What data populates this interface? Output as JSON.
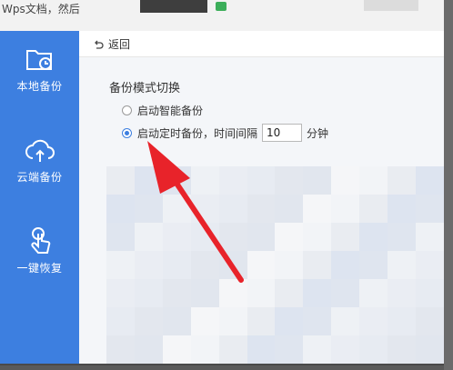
{
  "background": {
    "doc_text": "Wps文档，然后"
  },
  "sidebar": {
    "items": [
      {
        "label": "本地备份",
        "icon": "folder-clock-icon"
      },
      {
        "label": "云端备份",
        "icon": "cloud-upload-icon"
      },
      {
        "label": "一键恢复",
        "icon": "tap-hand-icon"
      }
    ]
  },
  "topbar": {
    "back_label": "返回",
    "back_icon": "undo-arrow-icon"
  },
  "backup_mode": {
    "title": "备份模式切换",
    "option_smart": "启动智能备份",
    "option_timed": "启动定时备份，时间间隔",
    "interval_value": "10",
    "interval_unit": "分钟",
    "selected": "timed"
  },
  "colors": {
    "sidebar": "#3d7fe0",
    "annotation_arrow": "#e8232a"
  }
}
